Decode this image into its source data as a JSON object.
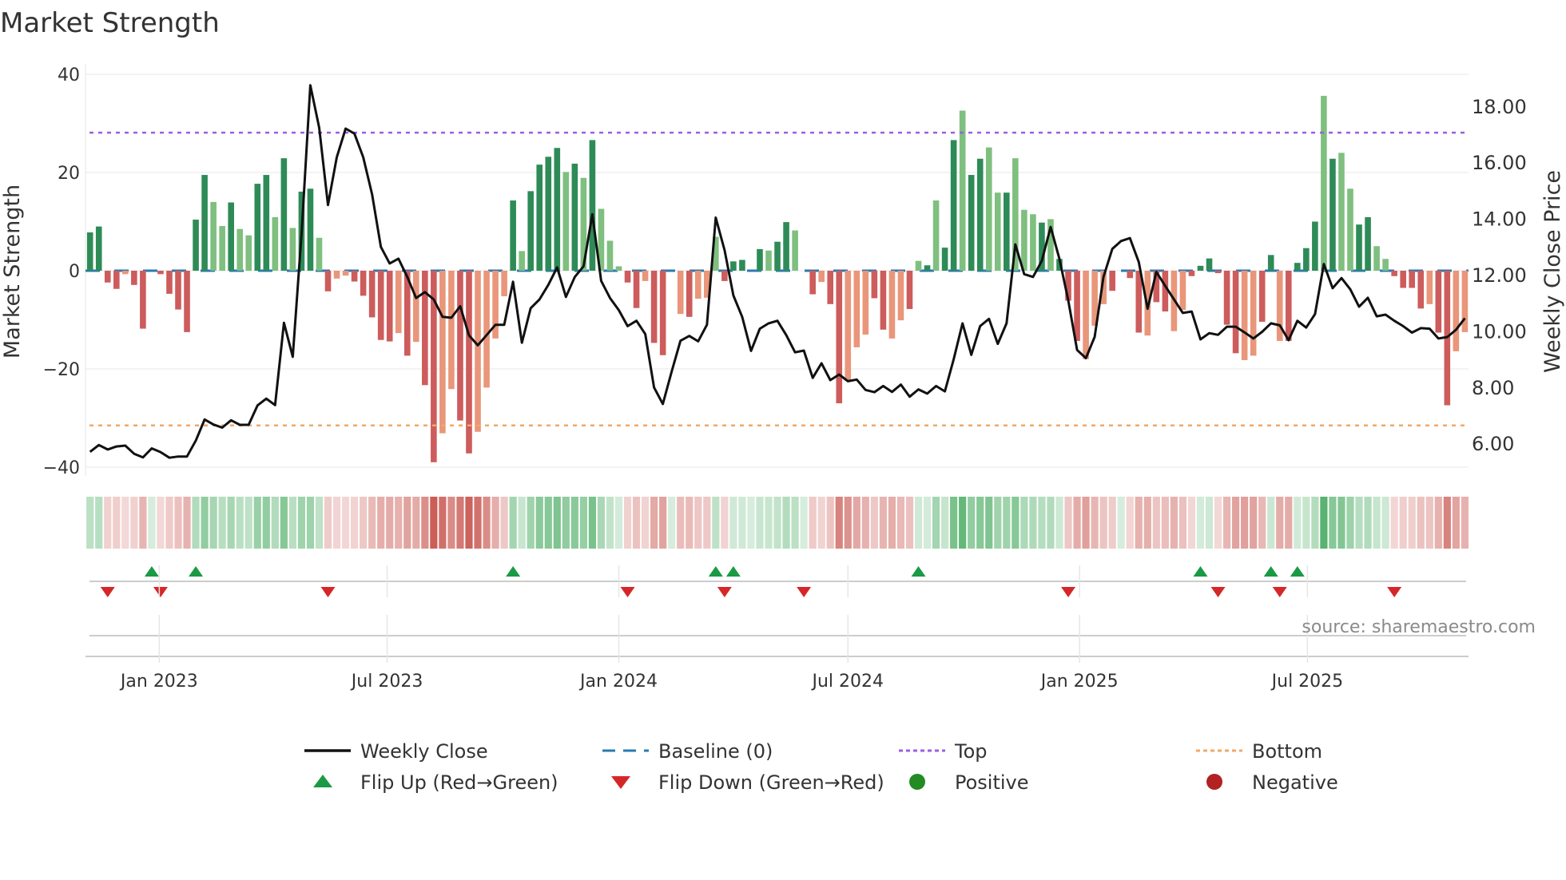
{
  "chart_data": {
    "type": "bar",
    "title": "Market Strength",
    "ylabel": "Market Strength",
    "y2label": "Weekly Close Price",
    "ylim": [
      -42,
      42
    ],
    "y2lim": [
      5.2,
      18.9
    ],
    "yticks": [
      "40",
      "20",
      "0",
      "−20",
      "−40"
    ],
    "ytick_values": [
      40,
      20,
      0,
      -20,
      -40
    ],
    "y2ticks": [
      "6.00",
      "8.00",
      "10.00",
      "12.00",
      "14.00",
      "16.00",
      "18.00"
    ],
    "y2tick_values": [
      6,
      8,
      10,
      12,
      14,
      16,
      18
    ],
    "xticks": [
      {
        "label": "Jan 2023",
        "date": "2023-01-01"
      },
      {
        "label": "Jul 2023",
        "date": "2023-07-01"
      },
      {
        "label": "Jan 2024",
        "date": "2024-01-01"
      },
      {
        "label": "Jul 2024",
        "date": "2024-07-01"
      },
      {
        "label": "Jan 2025",
        "date": "2025-01-01"
      },
      {
        "label": "Jul 2025",
        "date": "2025-07-01"
      }
    ],
    "start_date": "2022-11-07",
    "frequency": "weekly",
    "strength": [
      7.8,
      9.0,
      -2.4,
      -3.7,
      -0.7,
      -2.9,
      -11.8,
      0,
      -0.7,
      -4.7,
      -7.9,
      -12.5,
      10.4,
      19.5,
      14.0,
      9.1,
      13.9,
      8.5,
      7.2,
      17.7,
      19.5,
      10.9,
      22.9,
      8.7,
      16.1,
      16.7,
      6.7,
      -4.2,
      -1.6,
      -1.0,
      -2.2,
      -5.1,
      -9.5,
      -14.1,
      -14.4,
      -12.7,
      -17.3,
      -14.5,
      -23.3,
      -39.0,
      -33.1,
      -24.1,
      -30.5,
      -37.2,
      -32.8,
      -23.8,
      -13.8,
      -5.2,
      14.3,
      4.0,
      16.2,
      21.6,
      23.2,
      25.0,
      20.1,
      21.8,
      18.9,
      26.6,
      12.6,
      6.1,
      0.9,
      -2.4,
      -7.6,
      -2.1,
      -14.7,
      -17.2,
      0,
      -8.8,
      -9.4,
      -5.7,
      -5.5,
      6.9,
      -2.1,
      1.9,
      2.2,
      0,
      4.4,
      4.1,
      5.9,
      9.9,
      8.2,
      0,
      -4.8,
      -2.3,
      -6.8,
      -27.0,
      -22.4,
      -15.6,
      -13.0,
      -5.6,
      -12.0,
      -13.8,
      -10.1,
      -7.8,
      2.0,
      1.1,
      14.3,
      4.7,
      26.6,
      32.6,
      19.5,
      22.8,
      25.1,
      15.9,
      15.9,
      22.9,
      12.4,
      11.5,
      9.8,
      10.5,
      2.4,
      -6.1,
      -14.3,
      -18.0,
      -11.2,
      -6.8,
      -4.1,
      0,
      -1.5,
      -12.6,
      -13.2,
      -6.4,
      -8.3,
      -12.3,
      -8.0,
      -1.1,
      1.0,
      2.5,
      -0.5,
      -11.0,
      -16.8,
      -18.2,
      -17.3,
      -10.4,
      3.2,
      -14.3,
      -14.3,
      1.6,
      4.6,
      10.0,
      35.6,
      22.8,
      24.0,
      16.7,
      9.4,
      10.9,
      5.0,
      2.4,
      -1.1,
      -3.5,
      -3.5,
      -7.7,
      -6.8,
      -12.6,
      -27.4,
      -16.4,
      -12.5
    ],
    "strength_shade": "DDDDLDD-DDDDDDLLDLLDDLDLDDLDLLDDDDDLDLDDLLDDLLLLDLDDDDLDLDLLLDDLDD-LDLLLDDD-DLDDL-DLDDLLLDDLLDLDLDDLDDLLDLLLDLDDDLLL-DDDLDDLLDDDDDDLLDDLDDDDLDLLDDLLDDDDLDDLL",
    "weekly_close": [
      5.7,
      5.94,
      5.78,
      5.89,
      5.92,
      5.63,
      5.5,
      5.82,
      5.69,
      5.49,
      5.53,
      5.53,
      6.1,
      6.85,
      6.67,
      6.56,
      6.82,
      6.66,
      6.66,
      7.35,
      7.59,
      7.36,
      10.29,
      9.08,
      13.44,
      18.74,
      17.23,
      14.48,
      16.18,
      17.2,
      17.02,
      16.18,
      14.86,
      12.99,
      12.4,
      12.57,
      11.92,
      11.17,
      11.38,
      11.12,
      10.5,
      10.47,
      10.88,
      9.84,
      9.49,
      9.85,
      10.22,
      10.22,
      11.75,
      9.58,
      10.81,
      11.12,
      11.64,
      12.26,
      11.21,
      11.92,
      12.3,
      14.15,
      11.78,
      11.17,
      10.74,
      10.17,
      10.36,
      9.89,
      7.99,
      7.4,
      8.56,
      9.65,
      9.82,
      9.63,
      10.22,
      14.03,
      12.87,
      11.26,
      10.5,
      9.29,
      10.08,
      10.27,
      10.36,
      9.85,
      9.24,
      9.3,
      8.33,
      8.85,
      8.25,
      8.45,
      8.21,
      8.27,
      7.9,
      7.82,
      8.04,
      7.83,
      8.09,
      7.66,
      7.92,
      7.77,
      8.04,
      7.85,
      8.99,
      10.27,
      9.15,
      10.17,
      10.43,
      9.54,
      10.27,
      13.08,
      12.02,
      11.92,
      12.49,
      13.7,
      12.56,
      11.09,
      9.32,
      9.03,
      9.79,
      11.92,
      12.92,
      13.2,
      13.3,
      12.45,
      10.79,
      12.1,
      11.6,
      11.12,
      10.64,
      10.69,
      9.7,
      9.92,
      9.86,
      10.15,
      10.15,
      9.95,
      9.73,
      9.97,
      10.27,
      10.2,
      9.67,
      10.36,
      10.12,
      10.6,
      12.38,
      11.52,
      11.88,
      11.48,
      10.86,
      11.18,
      10.52,
      10.58,
      10.36,
      10.17,
      9.94,
      10.1,
      10.08,
      9.73,
      9.78,
      10.04,
      10.45
    ],
    "baseline": 0,
    "top_level": 28.1,
    "bottom_level": -31.5,
    "flip_up_dates": [
      "2022-12-26",
      "2023-01-30",
      "2023-10-09",
      "2024-03-18",
      "2024-04-01",
      "2024-08-26",
      "2025-04-07",
      "2025-06-02",
      "2025-06-23"
    ],
    "flip_down_dates": [
      "2022-11-21",
      "2023-01-02",
      "2023-05-15",
      "2024-01-08",
      "2024-03-25",
      "2024-05-27",
      "2024-12-23",
      "2025-04-21",
      "2025-06-09",
      "2025-09-08"
    ],
    "grid": true,
    "legend_position": "bottom",
    "legend": [
      {
        "label": "Weekly Close",
        "symbol": "line"
      },
      {
        "label": "Baseline (0)",
        "symbol": "dashed"
      },
      {
        "label": "Top",
        "symbol": "dotted-top"
      },
      {
        "label": "Bottom",
        "symbol": "dotted-bottom"
      },
      {
        "label": "Flip Up (Red→Green)",
        "symbol": "triangle-up"
      },
      {
        "label": "Flip Down (Green→Red)",
        "symbol": "triangle-down"
      },
      {
        "label": "Positive",
        "symbol": "circle-positive"
      },
      {
        "label": "Negative",
        "symbol": "circle-negative"
      }
    ],
    "annotation": "source: sharemaestro.com"
  },
  "colors": {
    "pos_dark": "#2e8b57",
    "pos_light": "#7fbf7f",
    "neg_dark": "#cd5c5c",
    "neg_light": "#e9967a",
    "baseline": "#2a7ab0",
    "top": "#9b5fe0",
    "bottom": "#f0a868",
    "line": "#111111",
    "flip_up": "#1a9a45",
    "flip_down": "#d62728",
    "positive": "#228b22",
    "negative": "#b22222"
  }
}
